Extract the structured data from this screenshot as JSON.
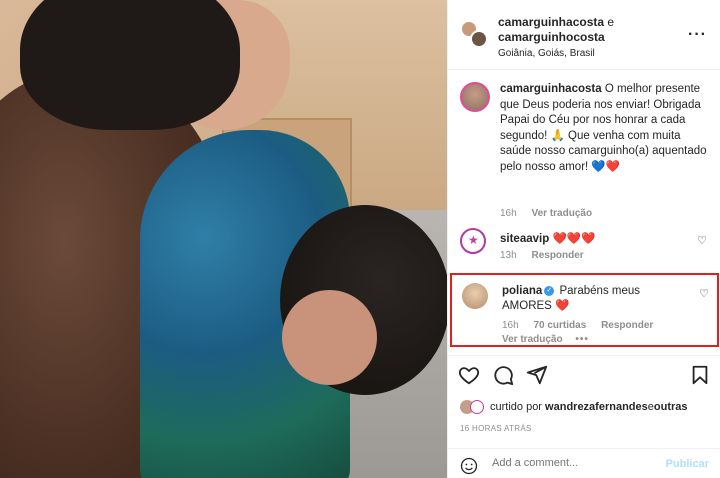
{
  "post": {
    "header": {
      "user1": "camarguinhacosta",
      "conj": " e",
      "user2": "camarguinhocosta",
      "location": "Goiânia, Goiás, Brasil"
    },
    "caption": {
      "username": "camarguinhacosta",
      "text": "O melhor presente que Deus poderia nos enviar! Obrigada Papai do Céu por nos honrar a cada segundo! 🙏 Que venha com muita saúde nosso camarguinho(a) aquentado pelo nosso amor! 💙❤️",
      "time": "16h",
      "translate": "Ver tradução"
    },
    "comments": [
      {
        "username": "siteaavip",
        "text": "❤️❤️❤️",
        "time": "13h",
        "reply": "Responder"
      },
      {
        "username": "poliana",
        "text": "Parabéns meus AMORES ❤️",
        "time": "16h",
        "likes": "70 curtidas",
        "reply": "Responder",
        "translate": "Ver tradução",
        "more": "•••"
      }
    ],
    "liked_by": {
      "prefix": "curtido por",
      "user": "wandrezafernandes",
      "suffix": "e",
      "others": "outras"
    },
    "timestamp": "16 HORAS ATRÁS",
    "add_comment": {
      "placeholder": "Add a comment...",
      "publish": "Publicar"
    }
  },
  "colors": {
    "highlight_border": "#e02020",
    "verified": "#3897f0",
    "publish_disabled": "#b2dffc"
  }
}
